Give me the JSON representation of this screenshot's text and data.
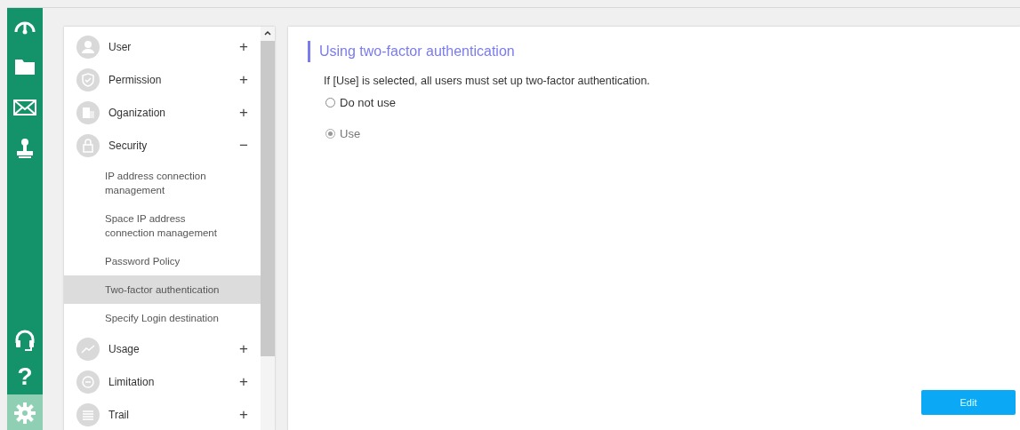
{
  "rail": {
    "top": [
      {
        "kind": "gauge",
        "selected": false
      },
      {
        "kind": "folder",
        "selected": false
      },
      {
        "kind": "mail",
        "selected": false
      },
      {
        "kind": "stamp",
        "selected": false
      }
    ],
    "bottom": [
      {
        "kind": "headset",
        "selected": false
      },
      {
        "kind": "help",
        "glyph": "?",
        "selected": false
      },
      {
        "kind": "gear",
        "selected": true
      }
    ]
  },
  "menu": [
    {
      "label": "User",
      "kind": "person",
      "toggle": "+"
    },
    {
      "label": "Permission",
      "kind": "shield",
      "toggle": "+"
    },
    {
      "label": "Oganization",
      "kind": "building",
      "toggle": "+"
    },
    {
      "label": "Security",
      "kind": "lock",
      "toggle": "−",
      "children": [
        {
          "label": "IP address connection management",
          "selected": false
        },
        {
          "label": "Space IP address connection management",
          "selected": false
        },
        {
          "label": "Password Policy",
          "selected": false
        },
        {
          "label": "Two-factor authentication",
          "selected": true
        },
        {
          "label": "Specify Login destination",
          "selected": false
        }
      ]
    },
    {
      "label": "Usage",
      "kind": "chart",
      "toggle": "+"
    },
    {
      "label": "Limitation",
      "kind": "minus",
      "toggle": "+"
    },
    {
      "label": "Trail",
      "kind": "lines",
      "toggle": "+"
    }
  ],
  "content": {
    "title": "Using two-factor authentication",
    "description": "If [Use] is selected, all users must set up two-factor authentication.",
    "options": [
      {
        "label": "Do not use",
        "selected": false,
        "disabled": false
      },
      {
        "label": "Use",
        "selected": true,
        "disabled": true
      }
    ],
    "button": "Edit"
  }
}
